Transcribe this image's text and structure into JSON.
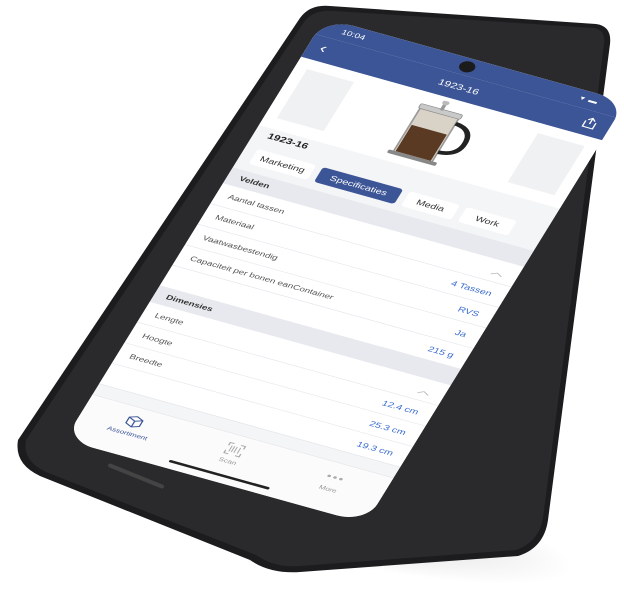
{
  "status": {
    "time": "10:04",
    "signal": "▾ ▬"
  },
  "nav": {
    "back": "‹",
    "title": "1923-16",
    "share_icon": "share-icon"
  },
  "product": {
    "sku": "1923-16",
    "image_icon": "french-press-icon"
  },
  "tabs": [
    {
      "label": "Marketing",
      "active": false
    },
    {
      "label": "Specificaties",
      "active": true
    },
    {
      "label": "Media",
      "active": false
    },
    {
      "label": "Work",
      "active": false
    }
  ],
  "sections": [
    {
      "title": "Velden",
      "rows": [
        {
          "label": "Aantal tassen",
          "value": ""
        },
        {
          "label": "Materiaal",
          "value": "4 Tassen"
        },
        {
          "label": "Vaatwasbestendig",
          "value": "RVS"
        },
        {
          "label": "Capaciteit per bonen eanContainer",
          "value": "Ja"
        }
      ],
      "trailing_value": "215 g"
    },
    {
      "title": "Dimensies",
      "rows": [
        {
          "label": "Lengte",
          "value": ""
        },
        {
          "label": "Hoogte",
          "value": "12.4 cm"
        },
        {
          "label": "Breedte",
          "value": "25.3 cm"
        }
      ],
      "trailing_value": "19.3 cm"
    }
  ],
  "bottom_nav": [
    {
      "label": "Assortiment",
      "icon": "box-icon",
      "active": true
    },
    {
      "label": "Scan",
      "icon": "scan-icon",
      "active": false
    },
    {
      "label": "More",
      "icon": "more-icon",
      "active": false
    }
  ],
  "colors": {
    "accent": "#3c5596",
    "value_blue": "#3c6ecf",
    "background": "#f4f5f7"
  }
}
